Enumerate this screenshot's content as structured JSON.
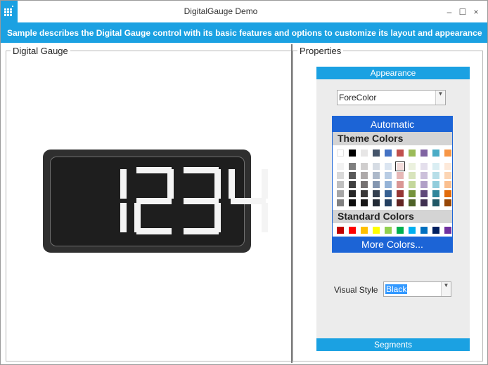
{
  "window": {
    "title": "DigitalGauge Demo",
    "minimize": "–",
    "maximize": "☐",
    "close": "×"
  },
  "banner": {
    "text": "Sample describes the Digital Gauge control with its basic features and options to customize its layout and appearance"
  },
  "gauge_group": {
    "title": "Digital Gauge"
  },
  "gauge": {
    "value": "1234",
    "segment_color": "#f4f4f4",
    "background_color": "#1e1e1e"
  },
  "properties_group": {
    "title": "Properties"
  },
  "appearance": {
    "header": "Appearance",
    "property_select": "ForeColor"
  },
  "color_palette": {
    "automatic": "Automatic",
    "theme_colors_label": "Theme Colors",
    "standard_colors_label": "Standard Colors",
    "more_colors": "More Colors...",
    "theme_top_row": [
      "#ffffff",
      "#000000",
      "#e7e6e6",
      "#44546a",
      "#4472c4",
      "#c0504d",
      "#9bbb59",
      "#8064a2",
      "#4bacc6",
      "#f79646"
    ],
    "theme_shades": [
      [
        "#f2f2f2",
        "#d9d9d9",
        "#bfbfbf",
        "#a6a6a6",
        "#808080"
      ],
      [
        "#7f7f7f",
        "#595959",
        "#404040",
        "#262626",
        "#0d0d0d"
      ],
      [
        "#d0cece",
        "#aeaaaa",
        "#757171",
        "#3a3838",
        "#171616"
      ],
      [
        "#d6dce4",
        "#adb9ca",
        "#8496b0",
        "#333f4f",
        "#222a35"
      ],
      [
        "#dbe5f1",
        "#b8cce4",
        "#95b3d7",
        "#366092",
        "#244061"
      ],
      [
        "#f2dcdb",
        "#e6b8b7",
        "#da9694",
        "#963634",
        "#632523"
      ],
      [
        "#ebf1de",
        "#d8e4bc",
        "#c4d79b",
        "#76933c",
        "#4f6228"
      ],
      [
        "#e4dfec",
        "#ccc0da",
        "#b1a0c7",
        "#60497a",
        "#403151"
      ],
      [
        "#daeef3",
        "#b7dee8",
        "#92cddc",
        "#31869b",
        "#215967"
      ],
      [
        "#fde9d9",
        "#fcd5b4",
        "#fabf8f",
        "#e26b0a",
        "#974706"
      ]
    ],
    "selected_swatch": "#f2dcdb",
    "standard": [
      "#c00000",
      "#ff0000",
      "#ffc000",
      "#ffff00",
      "#92d050",
      "#00b050",
      "#00b0f0",
      "#0070c0",
      "#002060",
      "#7030a0"
    ]
  },
  "visual_style": {
    "label": "Visual Style",
    "value": "Black"
  },
  "segments": {
    "header": "Segments"
  },
  "colors": {
    "accent": "#1ba1e2",
    "palette_blue": "#1c64d6"
  }
}
